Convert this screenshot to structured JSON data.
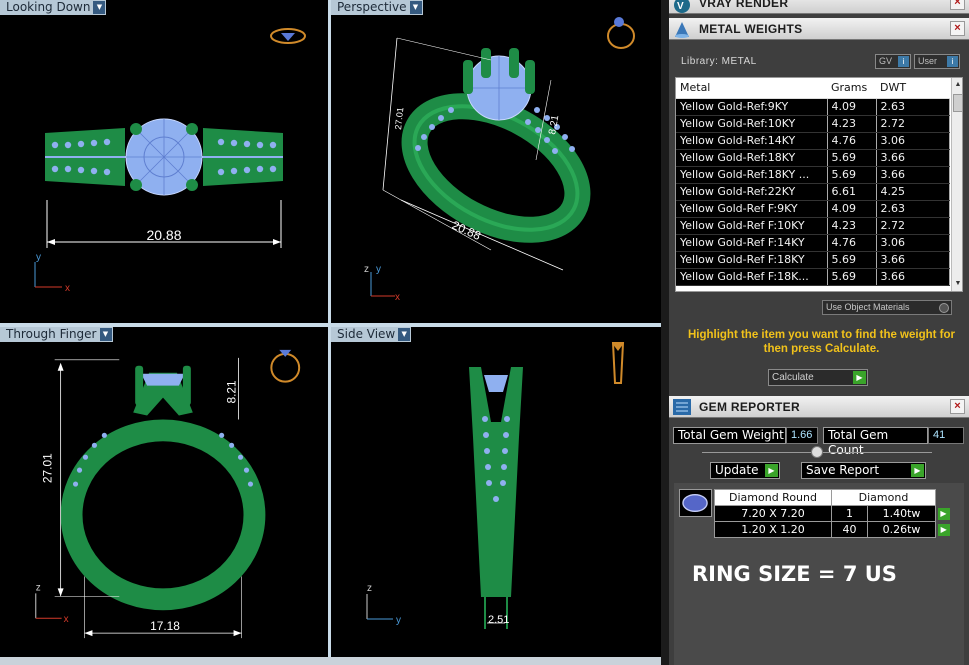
{
  "viewports": {
    "top": {
      "label": "Looking Down",
      "dim_width": "20.88"
    },
    "perspective": {
      "label": "Perspective",
      "dim_a": "20.88",
      "dim_b": "27.01",
      "dim_c": "8.21"
    },
    "front": {
      "label": "Through Finger",
      "dim_height": "27.01",
      "dim_top": "8.21",
      "dim_width": "17.18"
    },
    "side": {
      "label": "Side View",
      "dim_width": "2.51"
    }
  },
  "colors": {
    "ring_green": "#1e8c46",
    "gem_blue": "#8fb0f0",
    "dim_white": "#ffffff",
    "axis_x": "#d43a2a",
    "axis_y": "#4a9ad8"
  },
  "vray_panel": {
    "title": "VRAY RENDER",
    "close": "×"
  },
  "metal_panel": {
    "title": "METAL WEIGHTS",
    "close": "×",
    "library_label": "Library: METAL",
    "gv_button": "GV",
    "user_button": "User",
    "columns": [
      "Metal",
      "Grams",
      "DWT"
    ],
    "rows": [
      [
        "Yellow Gold-Ref:9KY",
        "4.09",
        "2.63"
      ],
      [
        "Yellow Gold-Ref:10KY",
        "4.23",
        "2.72"
      ],
      [
        "Yellow Gold-Ref:14KY",
        "4.76",
        "3.06"
      ],
      [
        "Yellow Gold-Ref:18KY",
        "5.69",
        "3.66"
      ],
      [
        "Yellow Gold-Ref:18KY ...",
        "5.69",
        "3.66"
      ],
      [
        "Yellow Gold-Ref:22KY",
        "6.61",
        "4.25"
      ],
      [
        "Yellow Gold-Ref F:9KY",
        "4.09",
        "2.63"
      ],
      [
        "Yellow Gold-Ref F:10KY",
        "4.23",
        "2.72"
      ],
      [
        "Yellow Gold-Ref F:14KY",
        "4.76",
        "3.06"
      ],
      [
        "Yellow Gold-Ref F:18KY",
        "5.69",
        "3.66"
      ],
      [
        "Yellow Gold-Ref F:18K...",
        "5.69",
        "3.66"
      ]
    ],
    "use_object_materials": "Use Object Materials",
    "hint": "Highlight the item you want to find the weight for then press Calculate.",
    "calculate_button": "Calculate"
  },
  "gem_panel": {
    "title": "GEM REPORTER",
    "close": "×",
    "total_weight_label": "Total Gem Weight",
    "total_weight_value": "1.66",
    "total_count_label": "Total Gem Count",
    "total_count_value": "41",
    "update_button": "Update",
    "save_report_button": "Save Report",
    "gem_table": {
      "header": [
        "Diamond Round",
        "Diamond"
      ],
      "rows": [
        [
          "7.20 X 7.20",
          "1",
          "1.40tw"
        ],
        [
          "1.20 X 1.20",
          "40",
          "0.26tw"
        ]
      ]
    },
    "ring_size": "RING SIZE = 7 US"
  }
}
